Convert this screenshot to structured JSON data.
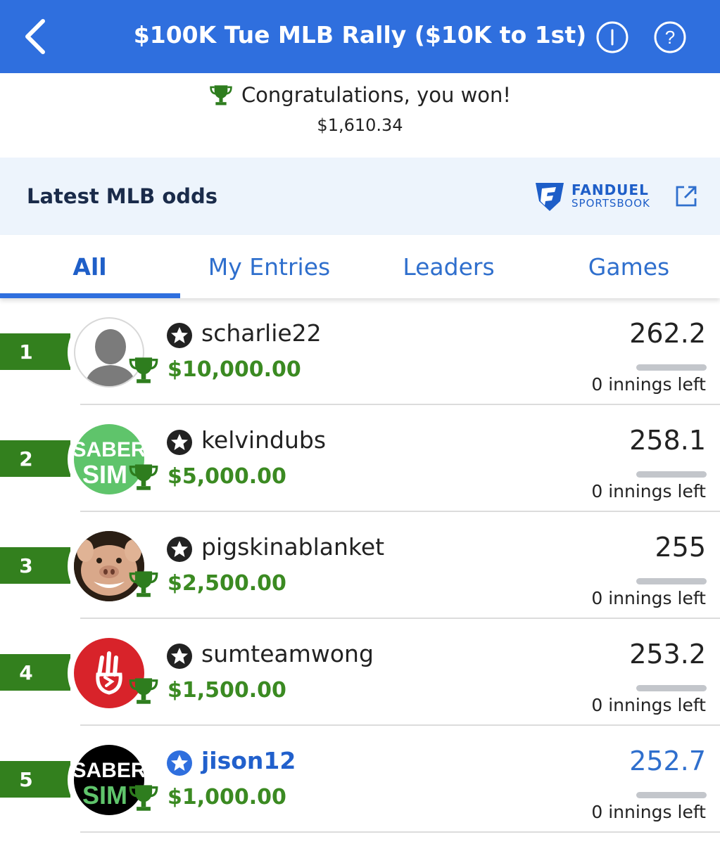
{
  "header": {
    "title": "$100K Tue MLB Rally ($10K to 1st)",
    "background": "#2f6fde"
  },
  "winnings": {
    "message": "Congratulations, you won!",
    "amount": "$1,610.34"
  },
  "odds": {
    "title": "Latest MLB odds",
    "brand": "FANDUEL",
    "brand_sub": "SPORTSBOOK"
  },
  "tabs": [
    {
      "label": "All",
      "active": true
    },
    {
      "label": "My Entries",
      "active": false
    },
    {
      "label": "Leaders",
      "active": false
    },
    {
      "label": "Games",
      "active": false
    }
  ],
  "entries": [
    {
      "rank": "1",
      "username": "scharlie22",
      "prize": "$10,000.00",
      "score": "262.2",
      "remaining": "0 innings left",
      "avatar": "default-person",
      "is_me": false
    },
    {
      "rank": "2",
      "username": "kelvindubs",
      "prize": "$5,000.00",
      "score": "258.1",
      "remaining": "0 innings left",
      "avatar": "sabersim-green",
      "avatar_text": [
        "SABER",
        "SIM"
      ],
      "is_me": false
    },
    {
      "rank": "3",
      "username": "pigskinablanket",
      "prize": "$2,500.00",
      "score": "255",
      "remaining": "0 innings left",
      "avatar": "pig-photo",
      "is_me": false
    },
    {
      "rank": "4",
      "username": "sumteamwong",
      "prize": "$1,500.00",
      "score": "253.2",
      "remaining": "0 innings left",
      "avatar": "hand-sign-red",
      "is_me": false
    },
    {
      "rank": "5",
      "username": "jison12",
      "prize": "$1,000.00",
      "score": "252.7",
      "remaining": "0 innings left",
      "avatar": "sabersim-black",
      "avatar_text": [
        "SABER",
        "SIM"
      ],
      "is_me": true
    }
  ],
  "colors": {
    "accent": "#2f6fde",
    "prize_green": "#3b8a22",
    "rank_green": "#33801e",
    "trophy_green": "#2e7d1e"
  }
}
